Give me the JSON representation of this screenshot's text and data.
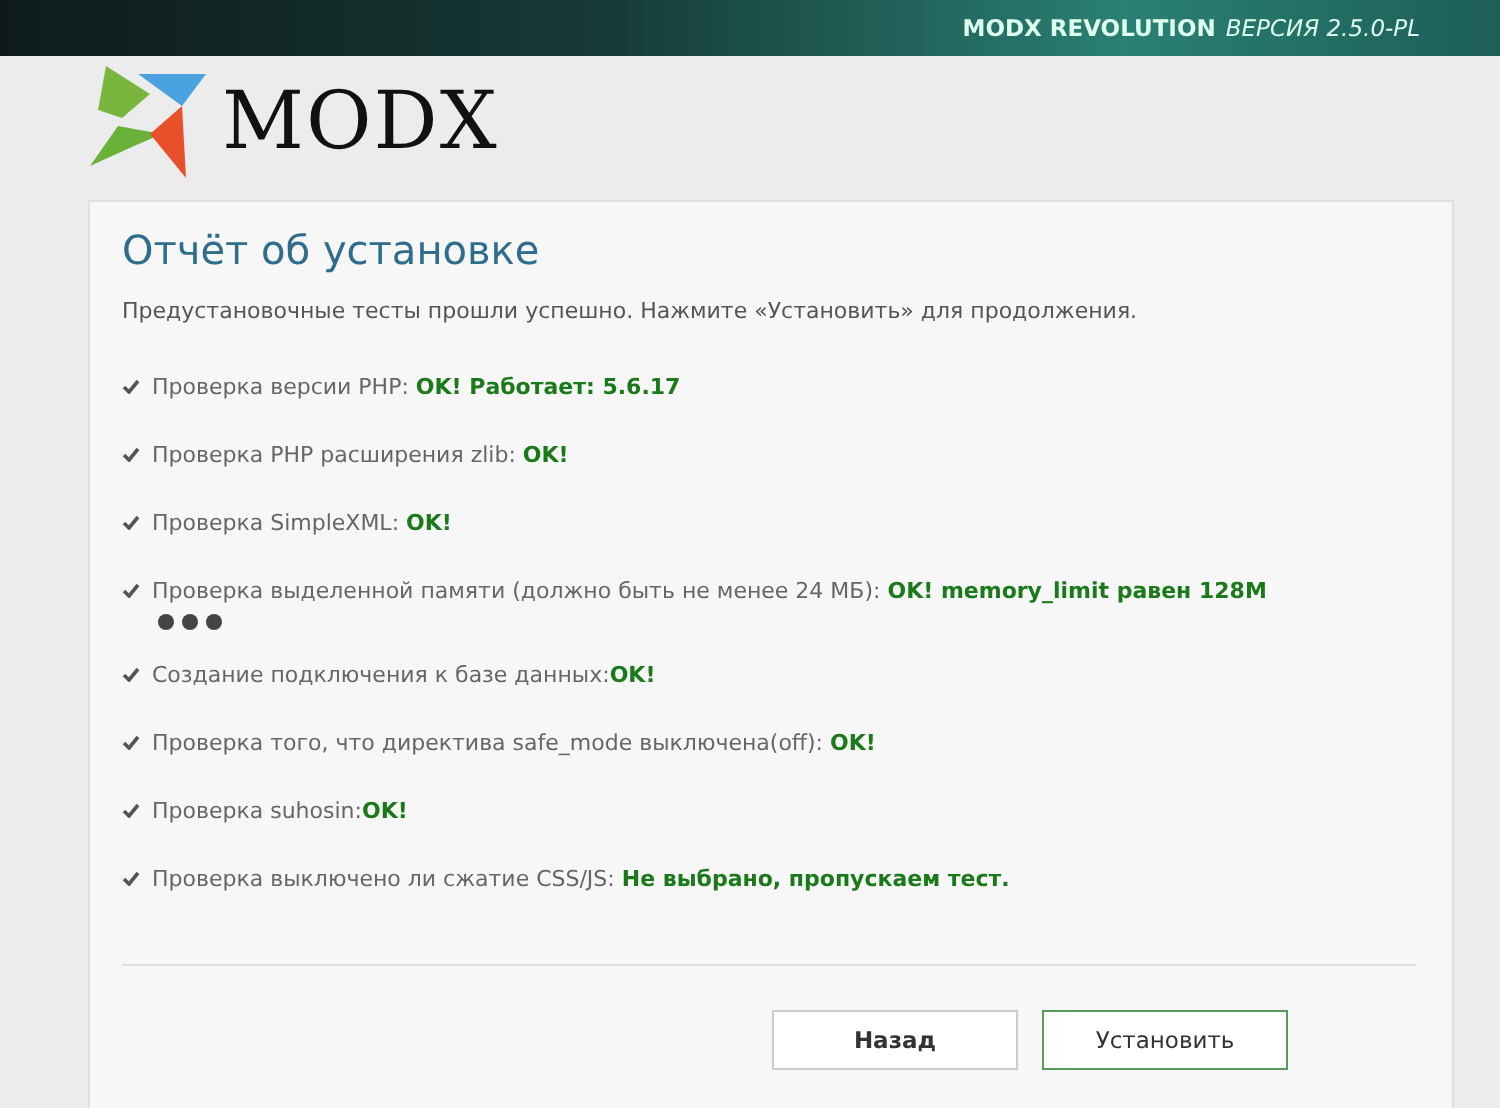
{
  "header": {
    "product": "MODX REVOLUTION",
    "version": "ВЕРСИЯ 2.5.0-PL"
  },
  "logo": {
    "text": "MODX"
  },
  "report": {
    "title": "Отчёт об установке",
    "intro": "Предустановочные тесты прошли успешно. Нажмите «Установить» для продолжения.",
    "checks": [
      {
        "label": "Проверка версии PHP: ",
        "result": "OK! Работает: 5.6.17"
      },
      {
        "label": "Проверка PHP расширения zlib: ",
        "result": "OK!"
      },
      {
        "label": "Проверка SimpleXML: ",
        "result": "OK!"
      },
      {
        "label": "Проверка выделенной памяти (должно быть не менее 24 МБ): ",
        "result": "OK! memory_limit равен 128M",
        "gap_after": true
      },
      {
        "label": "Создание подключения к базе данных:",
        "result": "OK!"
      },
      {
        "label": "Проверка того, что директива safe_mode выключена(off): ",
        "result": "OK!"
      },
      {
        "label": "Проверка suhosin:",
        "result": "OK!"
      },
      {
        "label": "Проверка выключено ли сжатие CSS/JS: ",
        "result": "Не выбрано, пропускаем тест."
      }
    ]
  },
  "buttons": [
    {
      "label": "Назад",
      "kind": "secondary"
    },
    {
      "label": "Установить",
      "kind": "primary"
    }
  ]
}
